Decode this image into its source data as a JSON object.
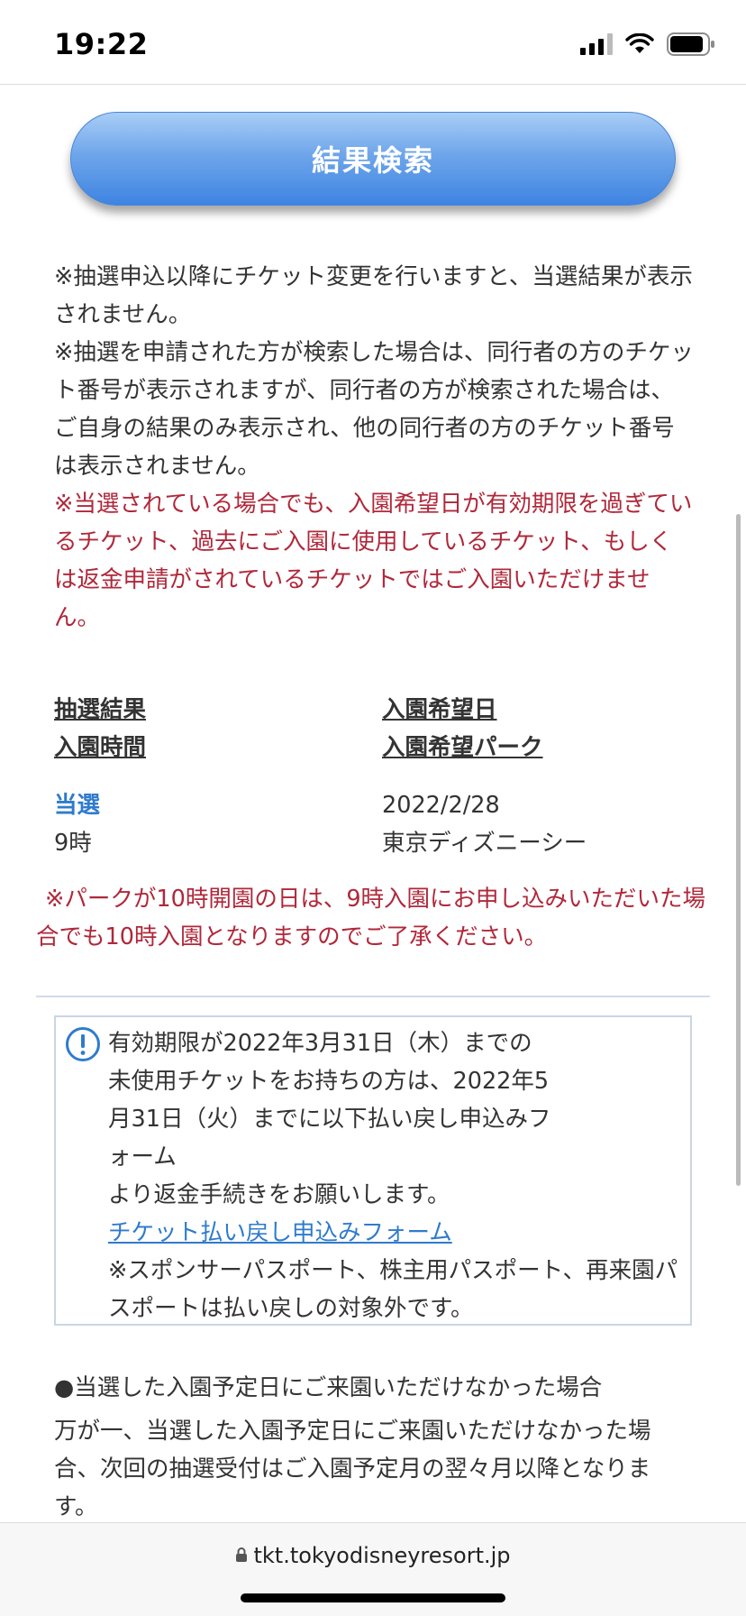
{
  "status_bar": {
    "time": "19:22"
  },
  "search_button": {
    "label": "結果検索"
  },
  "notes": [
    {
      "text": "※抽選申込以降にチケット変更を行いますと、当選結果が表示されません。",
      "highlight": false
    },
    {
      "text": "※抽選を申請された方が検索した場合は、同行者の方のチケット番号が表示されますが、同行者の方が検索された場合は、ご自身の結果のみ表示され、他の同行者の方のチケット番号は表示されません。",
      "highlight": false
    },
    {
      "text": "※当選されている場合でも、入園希望日が有効期限を過ぎているチケット、過去にご入園に使用しているチケット、もしくは返金申請がされているチケットではご入園いただけません。",
      "highlight": true
    }
  ],
  "result": {
    "labels": {
      "lottery_result": "抽選結果",
      "entry_time": "入園時間",
      "desired_date": "入園希望日",
      "desired_park": "入園希望パーク"
    },
    "values": {
      "lottery_result": "当選",
      "entry_time": "9時",
      "desired_date": "2022/2/28",
      "desired_park": "東京ディズニーシー"
    }
  },
  "park_note": "※パークが10時開園の日は、9時入園にお申し込みいただいた場合でも10時入園となりますのでご了承ください。",
  "info_box": {
    "icon": "exclamation-circle-icon",
    "lines": [
      "有効期限が2022年3月31日（木）までの",
      "未使用チケットをお持ちの方は、2022年5",
      "月31日（火）までに以下払い戻し申込みフ",
      "ォーム",
      "より返金手続きをお願いします。"
    ],
    "link_text": "チケット払い戻し申込みフォーム",
    "footnote": "※スポンサーパスポート、株主用パスポート、再来園パスポートは払い戻しの対象外です。"
  },
  "bottom": {
    "heading": "●当選した入園予定日にご来園いただけなかった場合",
    "paragraph": "万が一、当選した入園予定日にご来園いただけなかった場合、次回の抽選受付はご入園予定月の翌々月以降となります。"
  },
  "url_bar": {
    "url": "tkt.tokyodisneyresort.jp"
  },
  "colors": {
    "accent": "#2f7bcd",
    "warning": "#b0283a",
    "button_top": "#a9cdf6",
    "button_bottom": "#3e84e2"
  }
}
